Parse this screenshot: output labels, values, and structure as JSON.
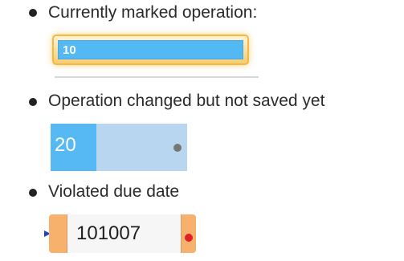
{
  "legend": {
    "items": [
      {
        "label": "Currently marked operation:",
        "operation_value": "10"
      },
      {
        "label": "Operation changed but not saved yet",
        "operation_value": "20"
      },
      {
        "label": "Violated due date",
        "operation_value": "101007"
      }
    ]
  },
  "colors": {
    "marked_glow": "#f5b93d",
    "marked_fill": "#54b8f2",
    "changed_left": "#56b9f3",
    "changed_right": "#b8d6ef",
    "violated_edge": "#f7b16d",
    "status_dot_gray": "#777777",
    "status_dot_red": "#e02020",
    "marker_arrow": "#1e45c8"
  },
  "icons": {
    "bullet": "bullet-icon",
    "unsaved_indicator": "gray-dot-icon",
    "due_date_violation_indicator": "red-dot-icon",
    "marker": "blue-marker-icon"
  }
}
